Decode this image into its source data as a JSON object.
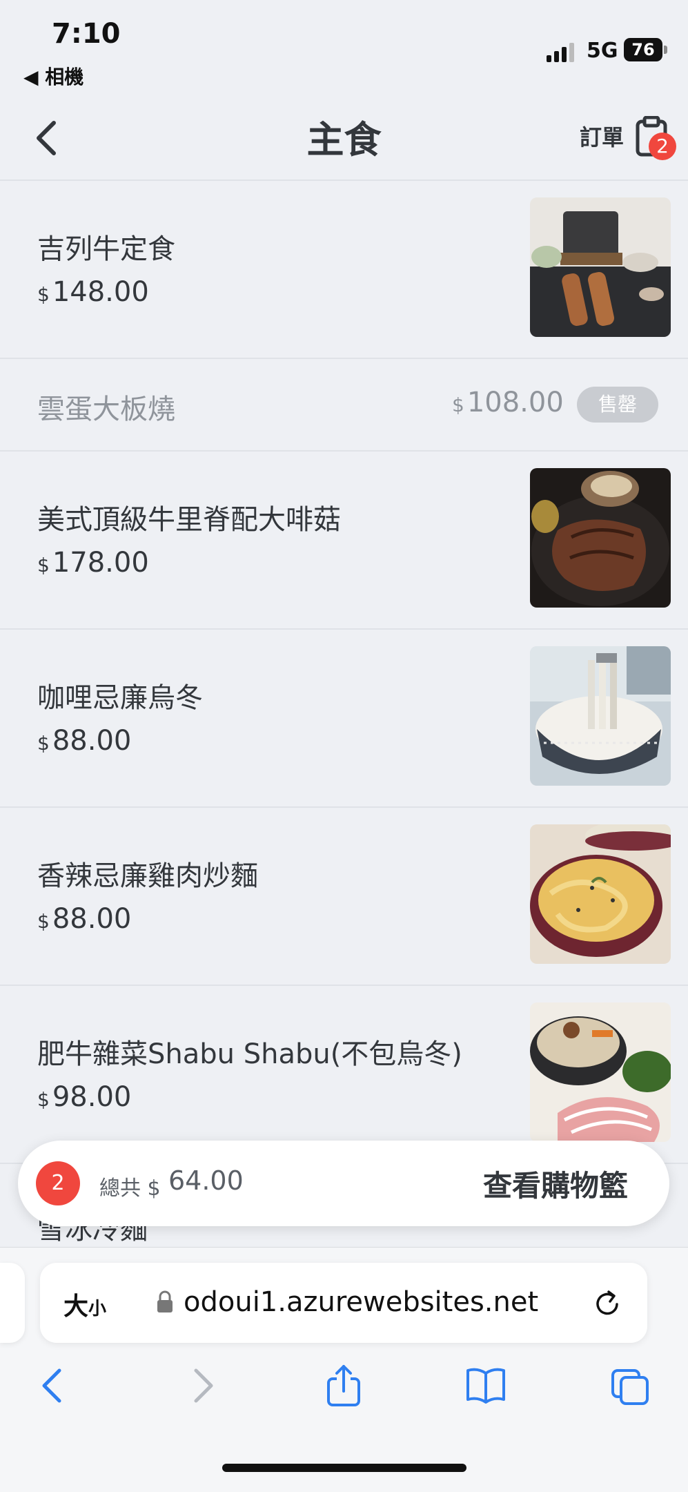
{
  "status_bar": {
    "time": "7:10",
    "back_app": "◀ 相機",
    "network": "5G",
    "battery": "76"
  },
  "header": {
    "title": "主食",
    "order_label": "訂單",
    "order_badge": "2"
  },
  "menu_items": [
    {
      "name": "吉列牛定食",
      "currency": "$",
      "price": "148.00"
    },
    {
      "name": "美式頂級牛里脊配大啡菇",
      "currency": "$",
      "price": "178.00"
    },
    {
      "name": "咖哩忌廉烏冬",
      "currency": "$",
      "price": "88.00"
    },
    {
      "name": "香辣忌廉雞肉炒麵",
      "currency": "$",
      "price": "88.00"
    },
    {
      "name": "肥牛雜菜Shabu Shabu(不包烏冬)",
      "currency": "$",
      "price": "98.00"
    }
  ],
  "sold_out_item": {
    "name": "雲蛋大板燒",
    "currency": "$",
    "price": "108.00",
    "badge": "售罄"
  },
  "partial_item": {
    "name": "雪冰冷麵"
  },
  "cart": {
    "count": "2",
    "total_label": "總共 $",
    "total_value": "64.00",
    "view_label": "查看購物籃"
  },
  "browser": {
    "text_size_big": "大",
    "text_size_small": "小",
    "url": "odoui1.azurewebsites.net"
  },
  "colors": {
    "accent_red": "#f0473e",
    "link_blue": "#2f7ff0",
    "background": "#eef0f4"
  }
}
